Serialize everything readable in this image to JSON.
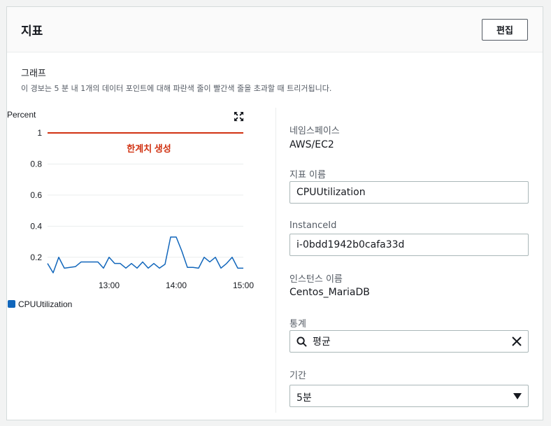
{
  "header": {
    "title": "지표",
    "edit_label": "편집"
  },
  "graph": {
    "heading": "그래프",
    "description": "이 경보는 5 분 내 1개의 데이터 포인트에 대해 파란색 줄이 빨간색 줄을 초과할 때 트리거됩니다."
  },
  "chart_data": {
    "type": "line",
    "ylabel": "Percent",
    "ylim": [
      0.1,
      1.0
    ],
    "y_ticks": [
      "1",
      "0.8",
      "0.6",
      "0.4",
      "0.2"
    ],
    "x_ticks": [
      "13:00",
      "14:00",
      "15:00"
    ],
    "threshold": {
      "value": 1,
      "label": "한계치 생성",
      "color": "#d13212"
    },
    "series": [
      {
        "name": "CPUUtilization",
        "color": "#1166bb",
        "x": [
          "12:05",
          "12:10",
          "12:15",
          "12:20",
          "12:25",
          "12:30",
          "12:35",
          "12:40",
          "12:45",
          "12:50",
          "12:55",
          "13:00",
          "13:05",
          "13:10",
          "13:15",
          "13:20",
          "13:25",
          "13:30",
          "13:35",
          "13:40",
          "13:45",
          "13:50",
          "13:55",
          "14:00",
          "14:05",
          "14:10",
          "14:15",
          "14:20",
          "14:25",
          "14:30",
          "14:35",
          "14:40",
          "14:45",
          "14:50",
          "14:55",
          "15:00"
        ],
        "values": [
          0.16,
          0.1,
          0.2,
          0.13,
          0.135,
          0.14,
          0.17,
          0.17,
          0.17,
          0.17,
          0.13,
          0.2,
          0.16,
          0.16,
          0.13,
          0.16,
          0.13,
          0.17,
          0.13,
          0.16,
          0.13,
          0.155,
          0.33,
          0.33,
          0.24,
          0.135,
          0.135,
          0.13,
          0.2,
          0.17,
          0.2,
          0.13,
          0.16,
          0.2,
          0.13,
          0.13
        ]
      }
    ],
    "legend": "bottom-left",
    "grid": true
  },
  "details": {
    "namespace_label": "네임스페이스",
    "namespace_value": "AWS/EC2",
    "metric_name_label": "지표 이름",
    "metric_name_value": "CPUUtilization",
    "instance_id_label": "InstanceId",
    "instance_id_value": "i-0bdd1942b0cafa33d",
    "instance_name_label": "인스턴스 이름",
    "instance_name_value": "Centos_MariaDB",
    "statistic_label": "통계",
    "statistic_value": "평균",
    "period_label": "기간",
    "period_value": "5분"
  }
}
